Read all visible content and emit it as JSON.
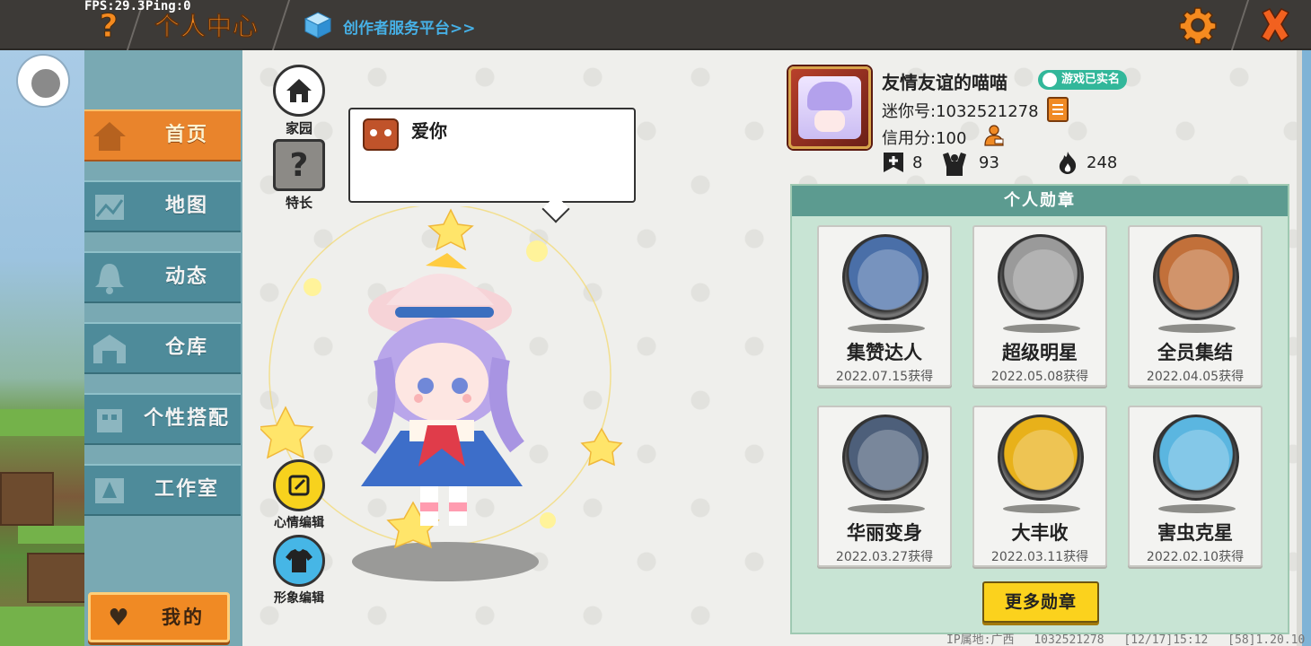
{
  "debug": {
    "fps": "FPS:29.3",
    "ping": "Ping:0"
  },
  "header": {
    "title": "个人中心",
    "platform_link": "创作者服务平台>>",
    "icons": [
      "help-icon",
      "gear-icon",
      "close-icon"
    ],
    "accent": "#f58a1f"
  },
  "sidebar": {
    "items": [
      {
        "label": "首页",
        "icon": "home-icon",
        "active": true
      },
      {
        "label": "地图",
        "icon": "map-icon",
        "active": false
      },
      {
        "label": "动态",
        "icon": "bell-icon",
        "active": false
      },
      {
        "label": "仓库",
        "icon": "warehouse-icon",
        "active": false
      },
      {
        "label": "个性搭配",
        "icon": "outfit-icon",
        "active": false
      },
      {
        "label": "工作室",
        "icon": "studio-icon",
        "active": false
      }
    ],
    "me_button": "我的"
  },
  "tools": {
    "home": "家园",
    "skill": "特长",
    "skill_glyph": "?",
    "mood_edit": "心情编辑",
    "look_edit": "形象编辑"
  },
  "speech": {
    "text": "爱你"
  },
  "profile": {
    "nickname": "友情友谊的喵喵",
    "verified_badge": "游戏已实名",
    "mini_id": "迷你号:1032521278",
    "credit": "信用分:100",
    "stats": [
      {
        "icon": "plus-flag-icon",
        "value": "8"
      },
      {
        "icon": "fans-icon",
        "value": "93"
      },
      {
        "icon": "flame-icon",
        "value": "248"
      }
    ]
  },
  "medals": {
    "header": "个人勋章",
    "items": [
      {
        "name": "集赞达人",
        "date": "2022.07.15获得",
        "color": "#4a6fa8"
      },
      {
        "name": "超级明星",
        "date": "2022.05.08获得",
        "color": "#9a9a9a"
      },
      {
        "name": "全员集结",
        "date": "2022.04.05获得",
        "color": "#c2703a"
      },
      {
        "name": "华丽变身",
        "date": "2022.03.27获得",
        "color": "#4d5f7a"
      },
      {
        "name": "大丰收",
        "date": "2022.03.11获得",
        "color": "#e8b11a"
      },
      {
        "name": "害虫克星",
        "date": "2022.02.10获得",
        "color": "#5bb6e0"
      }
    ],
    "more_button": "更多勋章"
  },
  "footer": {
    "ip": "IP属地:广西",
    "uid": "1032521278",
    "time": "[12/17]15:12",
    "version": "[58]1.20.10"
  }
}
